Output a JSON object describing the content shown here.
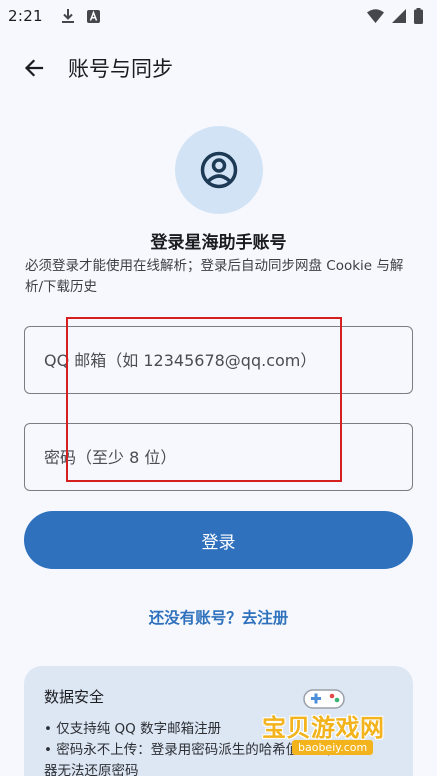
{
  "status_bar": {
    "time": "2:21",
    "icons": [
      "download-icon",
      "keyboard-a-icon",
      "wifi-icon",
      "signal-icon",
      "battery-icon"
    ]
  },
  "app_bar": {
    "title": "账号与同步",
    "back_icon": "arrow-back-icon"
  },
  "login": {
    "avatar_icon": "account-circle-icon",
    "heading": "登录星海助手账号",
    "description": "必须登录才能使用在线解析；登录后自动同步网盘 Cookie 与解析/下载历史",
    "email_placeholder": "QQ 邮箱（如 12345678@qq.com）",
    "password_placeholder": "密码（至少 8 位）",
    "login_button": "登录",
    "register_link": "还没有账号？去注册"
  },
  "security": {
    "title": "数据安全",
    "items": [
      "• 仅支持纯 QQ 数字邮箱注册",
      "• 密码永不上传：登录用密码派生的哈希值验证，服务",
      "器无法还原密码"
    ]
  },
  "watermark": {
    "text": "宝贝游戏网",
    "url": "baobeiy.com"
  },
  "colors": {
    "accent": "#2f71bd",
    "background": "#f6f8fd",
    "avatar_bg": "#d3e3f6",
    "card_bg": "#dde6f3",
    "annotation_red": "#d62020"
  }
}
